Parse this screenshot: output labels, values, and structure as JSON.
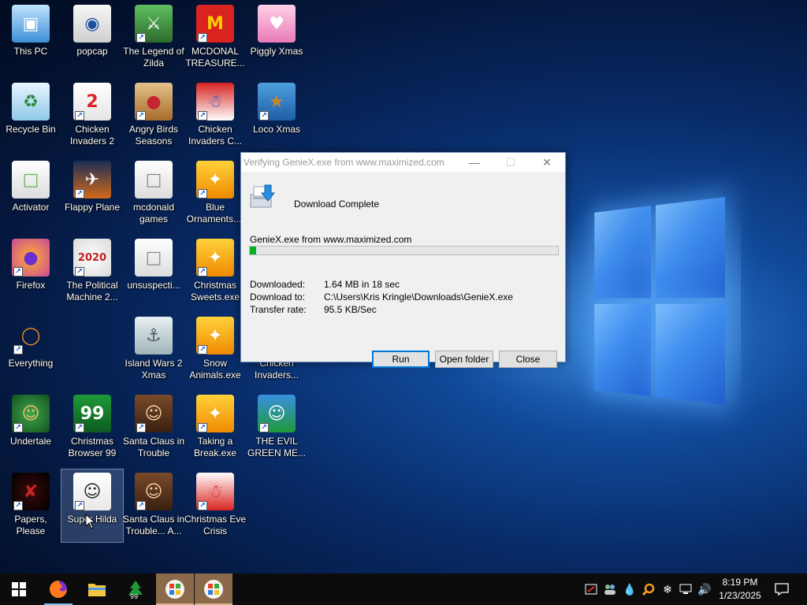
{
  "desktop": {
    "icons": [
      {
        "label": "This PC",
        "name": "this-pc"
      },
      {
        "label": "popcap",
        "name": "popcap"
      },
      {
        "label": "The Legend of Zilda",
        "name": "legend-of-zilda"
      },
      {
        "label": "MCDONAL TREASURE...",
        "name": "mcdonal-treasure"
      },
      {
        "label": "Piggly Xmas",
        "name": "piggly-xmas"
      },
      {
        "label": "Recycle Bin",
        "name": "recycle-bin"
      },
      {
        "label": "Chicken Invaders 2",
        "name": "chicken-invaders-2"
      },
      {
        "label": "Angry Birds Seasons",
        "name": "angry-birds-seasons"
      },
      {
        "label": "Chicken Invaders C...",
        "name": "chicken-invaders-c"
      },
      {
        "label": "Loco Xmas",
        "name": "loco-xmas"
      },
      {
        "label": "Activator",
        "name": "activator"
      },
      {
        "label": "Flappy Plane",
        "name": "flappy-plane"
      },
      {
        "label": "mcdonald games",
        "name": "mcdonald-games"
      },
      {
        "label": "Blue Ornaments....",
        "name": "blue-ornaments"
      },
      {
        "label": "Firefox",
        "name": "firefox"
      },
      {
        "label": "The Political Machine 2...",
        "name": "political-machine"
      },
      {
        "label": "unsuspecti...",
        "name": "unsuspecti"
      },
      {
        "label": "Christmas Sweets.exe",
        "name": "christmas-sweets"
      },
      {
        "label": "Everything",
        "name": "everything"
      },
      {
        "label": "Island Wars 2 Xmas",
        "name": "island-wars-2-xmas"
      },
      {
        "label": "Snow Animals.exe",
        "name": "snow-animals"
      },
      {
        "label": "Chicken Invaders...",
        "name": "chicken-invaders-3"
      },
      {
        "label": "Undertale",
        "name": "undertale"
      },
      {
        "label": "Christmas Browser 99",
        "name": "christmas-browser-99"
      },
      {
        "label": "Santa Claus in Trouble",
        "name": "santa-claus-in-trouble"
      },
      {
        "label": "Taking a Break.exe",
        "name": "taking-a-break"
      },
      {
        "label": "THE EVIL GREEN ME...",
        "name": "the-evil-green-me"
      },
      {
        "label": "Papers, Please",
        "name": "papers-please"
      },
      {
        "label": "Super Hilda",
        "name": "super-hilda"
      },
      {
        "label": "Santa Claus in Trouble... A...",
        "name": "santa-claus-in-trouble-a"
      },
      {
        "label": "Christmas Eve Crisis",
        "name": "christmas-eve-crisis"
      }
    ]
  },
  "dialog": {
    "title": "Verifying GenieX.exe from www.maximized.com",
    "status": "Download Complete",
    "file_line": "GenieX.exe from www.maximized.com",
    "progress": 0.02,
    "downloaded_label": "Downloaded:",
    "downloaded_value": "1.64 MB in 18 sec",
    "download_to_label": "Download to:",
    "download_to_value": "C:\\Users\\Kris Kringle\\Downloads\\GenieX.exe",
    "rate_label": "Transfer rate:",
    "rate_value": "95.5 KB/Sec",
    "run_label": "Run",
    "open_folder_label": "Open folder",
    "close_label": "Close"
  },
  "taskbar": {
    "time": "8:19 PM",
    "date": "1/23/2025"
  },
  "colors": {
    "progress_fill": "#06b025",
    "default_button_border": "#0078d7"
  }
}
